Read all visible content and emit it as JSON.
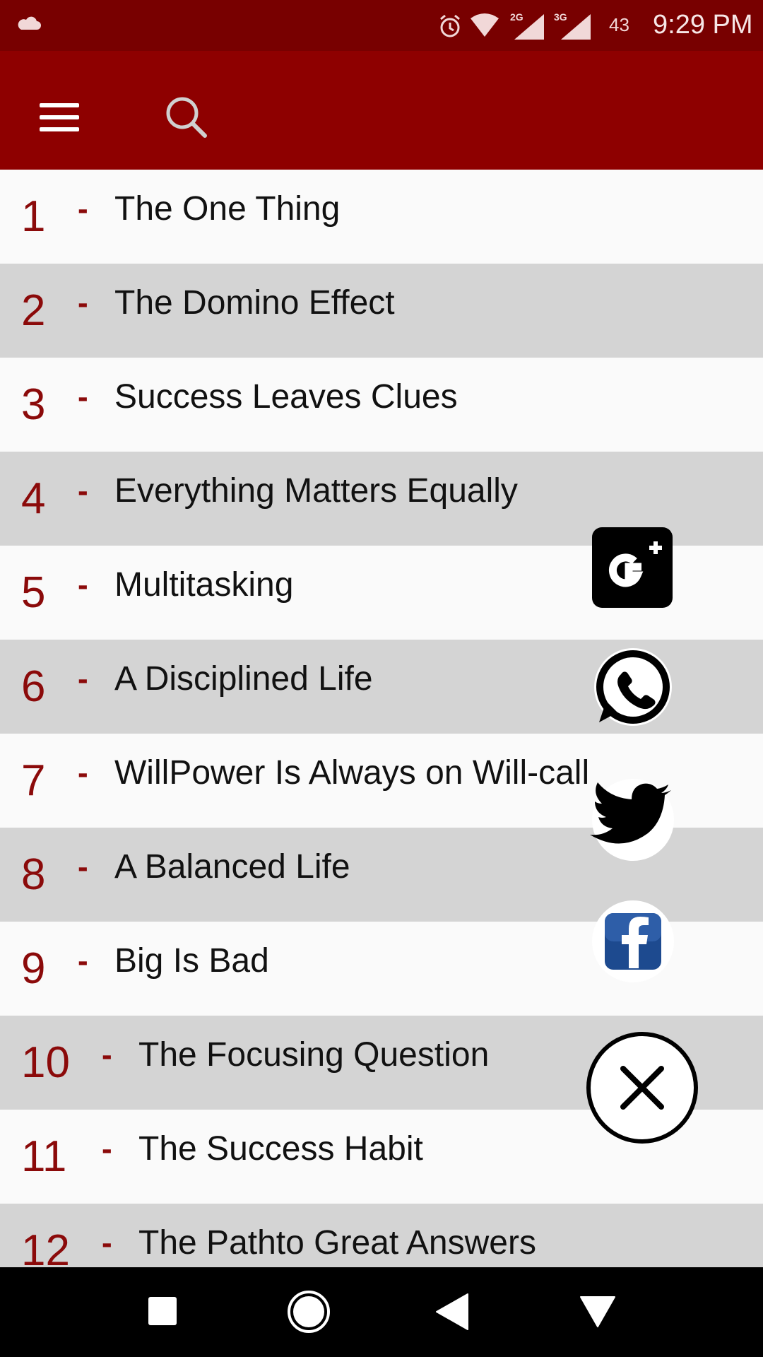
{
  "status_bar": {
    "network_tag_1": "2G",
    "network_tag_2": "3G",
    "battery": "43",
    "time": "9:29 PM"
  },
  "app_bar": {
    "menu_icon": "hamburger-menu-icon",
    "search_icon": "search-icon"
  },
  "chapters": [
    {
      "num": "1",
      "title": "The One Thing"
    },
    {
      "num": "2",
      "title": "The Domino Effect"
    },
    {
      "num": "3",
      "title": "Success  Leaves Clues"
    },
    {
      "num": "4",
      "title": "Everything Matters Equally"
    },
    {
      "num": "5",
      "title": "Multitasking"
    },
    {
      "num": "6",
      "title": "A Disciplined Life"
    },
    {
      "num": "7",
      "title": "WillPower Is Always on Will-call"
    },
    {
      "num": "8",
      "title": "A Balanced Life"
    },
    {
      "num": "9",
      "title": "Big Is Bad"
    },
    {
      "num": "10",
      "title": "The  Focusing Question"
    },
    {
      "num": "11",
      "title": "The  Success  Habit"
    },
    {
      "num": "12",
      "title": "The  Pathto  Great Answers"
    }
  ],
  "dash": "-",
  "share_menu": {
    "items": [
      "google-plus-icon",
      "whatsapp-icon",
      "twitter-icon",
      "facebook-icon",
      "close-icon"
    ]
  },
  "nav_bar": {
    "buttons": [
      "recents-square-icon",
      "home-circle-icon",
      "back-triangle-icon",
      "notifications-down-icon"
    ]
  },
  "colors": {
    "status_bar": "#780000",
    "app_bar": "#8e0000",
    "accent_text": "#8b0a0a",
    "row_light": "#fafafa",
    "row_dark": "#d4d4d4"
  }
}
